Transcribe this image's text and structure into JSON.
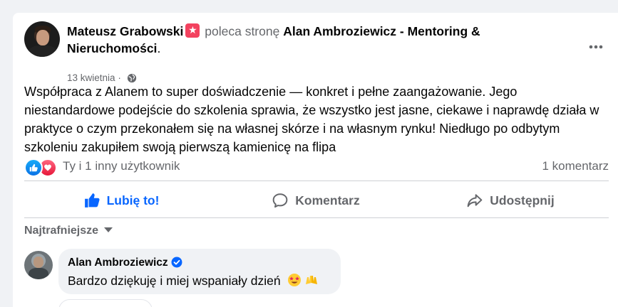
{
  "post": {
    "author": "Mateusz Grabowski",
    "action": "poleca stronę",
    "page_name": "Alan Ambroziewicz - Mentoring & Nieruchomości",
    "page_name_suffix": ".",
    "date": "13 kwietnia",
    "separator": "·",
    "body": "Współpraca z Alanem to super doświadczenie — konkret i pełne zaangażowanie. Jego niestandardowe podejście do szkolenia sprawia, że wszystko jest jasne, ciekawe i naprawdę działa w praktyce o czym przekonałem się na własnej skórze i na własnym rynku!  Niedługo po odbytym szkoleniu zakupiłem swoją pierwszą kamienicę na flipa"
  },
  "reactions": {
    "summary": "Ty i 1 inny użytkownik",
    "comments_count": "1 komentarz",
    "icons": [
      "like-icon",
      "love-icon"
    ]
  },
  "actions": {
    "like": "Lubię to!",
    "comment": "Komentarz",
    "share": "Udostępnij"
  },
  "comments": {
    "sort_label": "Najtrafniejsze",
    "items": [
      {
        "author": "Alan Ambroziewicz",
        "text": "Bardzo dziękuję i miej wspaniały dzień"
      }
    ]
  },
  "colors": {
    "accent": "#0866ff",
    "secondary_text": "#65676b",
    "love": "#f3425f"
  }
}
